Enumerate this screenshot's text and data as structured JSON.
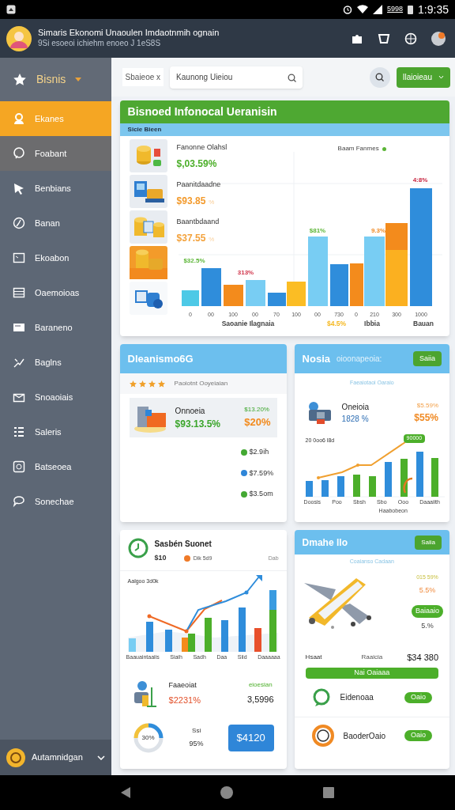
{
  "status_bar": {
    "carrier": "5998",
    "time": "1:9:35"
  },
  "header": {
    "title": "Simaris Ekonomi Unaoulen Imdaotnmih ognain",
    "subtitle": "9Si esoeoi ichiehm enoeo J 1eS8S"
  },
  "sidebar": {
    "section": "Bisnis",
    "items": [
      {
        "label": "Ekanes",
        "selected": true,
        "highlighted": false
      },
      {
        "label": "Foabant",
        "selected": false,
        "highlighted": true
      },
      {
        "label": "Benbians",
        "selected": false,
        "highlighted": false
      },
      {
        "label": "Banan",
        "selected": false,
        "highlighted": false
      },
      {
        "label": "Ekoabon",
        "selected": false,
        "highlighted": false
      },
      {
        "label": "Oaemoioas",
        "selected": false,
        "highlighted": false
      },
      {
        "label": "Baraneno",
        "selected": false,
        "highlighted": false
      },
      {
        "label": "Baglns",
        "selected": false,
        "highlighted": false
      },
      {
        "label": "Snoaoiais",
        "selected": false,
        "highlighted": false
      },
      {
        "label": "Saleris",
        "selected": false,
        "highlighted": false
      },
      {
        "label": "Batseoea",
        "selected": false,
        "highlighted": false
      },
      {
        "label": "Sonechae",
        "selected": false,
        "highlighted": false
      }
    ],
    "footer": "Autamnidgan"
  },
  "toolbar": {
    "filter_chip": "Sbaieoe x",
    "search": {
      "value": "Kaunong Uieiou"
    },
    "dropdown_button": "Ilaioieau"
  },
  "overview_card": {
    "title": "Bisnoed Infonocal Ueranisin",
    "subtitle": "Sicie Bieen",
    "metrics": [
      {
        "label": "Fanonne Olahsl",
        "value": "$,03.59%",
        "color": "#4caf2a"
      },
      {
        "label": "Paanitdaadne",
        "value": "$93.85",
        "unit": "%",
        "color": "#f39a2c"
      },
      {
        "label": "Baantbdaand",
        "value": "$37.55",
        "unit": "%",
        "color": "#f3a23c"
      }
    ],
    "legend": "Baam Fanmes",
    "bar_labels": [
      {
        "text": "$32.5%",
        "color": "#5bb536"
      },
      {
        "text": "313%",
        "color": "#d0344a"
      },
      {
        "text": "$81%",
        "color": "#5bb536"
      },
      {
        "text": "9.3%",
        "color": "#f08a24"
      },
      {
        "text": "4:8%",
        "color": "#c8243f"
      }
    ],
    "x_labels": [
      "0",
      "00",
      "100",
      "00",
      "70",
      "100",
      "00",
      "730",
      "0",
      "210",
      "300",
      "1000"
    ],
    "x_sublabels": [
      {
        "text": "Saoanie  Ilagnaia",
        "color": "#444444"
      },
      {
        "text": "$4.5%",
        "color": "#f5b820"
      },
      {
        "text": "Ibbia",
        "color": "#444444"
      },
      {
        "text": "Bauan",
        "color": "#444444"
      }
    ]
  },
  "ratings_card": {
    "title": "Dleanismo6G",
    "stars": 4,
    "rating_label": "Paoiotnt Ooyeiaian",
    "item": {
      "name": "Onnoeia",
      "value": "$93.13.5%",
      "change": "$13.20%",
      "percent": "$20%"
    },
    "entries": [
      {
        "value": "$2.9ih",
        "color": "#43a832"
      },
      {
        "value": "$7.59%",
        "color": "#2f86d8"
      },
      {
        "value": "$3.5om",
        "color": "#43a832"
      }
    ]
  },
  "trend_card": {
    "title": "Nosia",
    "title_note": "oioonapeoia:",
    "button": "Saiia",
    "subtitle": "Faeaiotaoi Oaraio",
    "item": {
      "name": "Oneioia",
      "value": "1828 %",
      "change": "$5.59%",
      "percent": "$55%"
    },
    "chart_label": "20 0oo6 l8d",
    "chart_badge": "90000",
    "x_labels": [
      "Doosis",
      "Poo",
      "Sbsh",
      "Sbo",
      "Ooo",
      "Daaaiith"
    ],
    "x_sublabel": "Haabobeon"
  },
  "sales_card": {
    "title": "Sasbén Suonet",
    "amount": "$10",
    "legend": "Dik 5d9",
    "corner_label": "Dab",
    "chart_label": "Aalgoo 3d0k",
    "x_labels": [
      "Baauaintaaiis",
      "Siaih",
      "Sadh",
      "Daa",
      "Siid",
      "Daaaaaa"
    ],
    "item": {
      "name": "Faaeoiat",
      "value": "$2231%",
      "note": "eioesian",
      "total": "3,5996"
    },
    "donut_label": "30%",
    "share": {
      "label": "Ssi",
      "value": "95%"
    },
    "button": "$4120"
  },
  "vehicle_card": {
    "title": "Dmahe llo",
    "button": "Saiia",
    "subtitle": "Coaianso Cadaan",
    "stats": [
      "015 59%",
      "5.5%"
    ],
    "badge": "Baiaaio",
    "badge_value": "5.%",
    "summary": {
      "label": "Hsaat",
      "note": "Raaicia",
      "amount": "$34 380"
    },
    "banner": "Nai Oaiaaa",
    "rows": [
      {
        "name": "Eidenoaa",
        "badge": "Oaio"
      },
      {
        "name": "BaoderOaio",
        "badge": "Oaio"
      }
    ]
  }
}
